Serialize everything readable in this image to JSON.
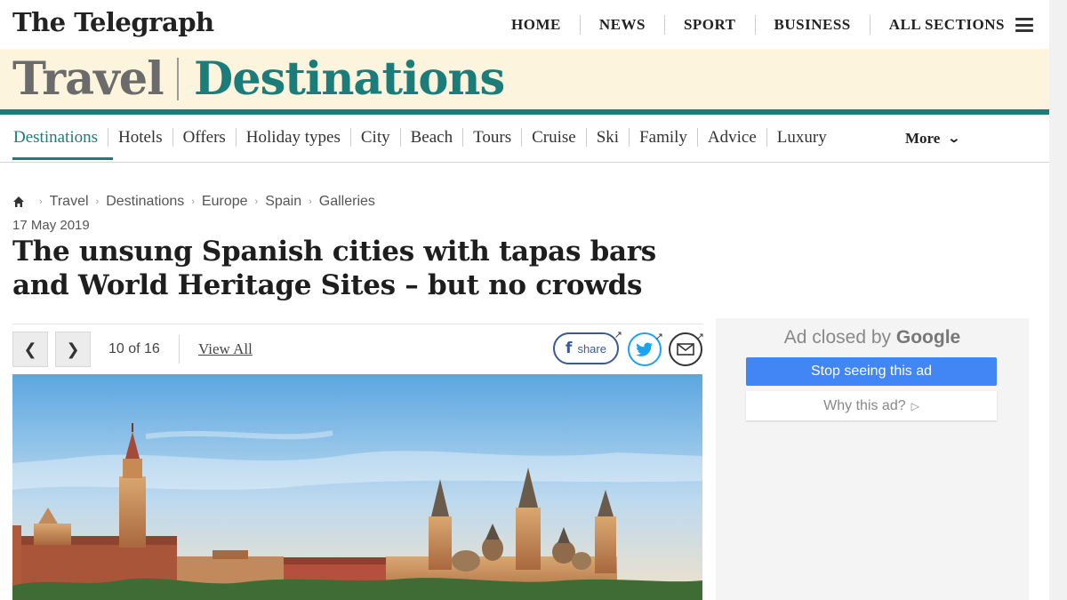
{
  "header": {
    "logo": "The Telegraph",
    "nav": [
      "HOME",
      "NEWS",
      "SPORT",
      "BUSINESS",
      "ALL SECTIONS"
    ],
    "menu_icon": "hamburger-icon"
  },
  "section": {
    "primary": "Travel",
    "secondary": "Destinations"
  },
  "subnav": {
    "items": [
      "Destinations",
      "Hotels",
      "Offers",
      "Holiday types",
      "City",
      "Beach",
      "Tours",
      "Cruise",
      "Ski",
      "Family",
      "Advice",
      "Luxury"
    ],
    "more_label": "More"
  },
  "breadcrumb": [
    "Travel",
    "Destinations",
    "Europe",
    "Spain",
    "Galleries"
  ],
  "article": {
    "date": "17 May 2019",
    "headline": "The unsung Spanish cities with tapas bars and World Heritage Sites – but no crowds"
  },
  "gallery": {
    "counter": "10 of 16",
    "view_all": "View All",
    "share_label": "share"
  },
  "ad": {
    "closed_prefix": "Ad closed by",
    "closed_brand": "Google",
    "stop_label": "Stop seeing this ad",
    "why_label": "Why this ad?"
  },
  "colors": {
    "accent": "#1a7d7a",
    "band": "#fcf4dd",
    "facebook": "#3b5998",
    "twitter": "#1da1f2",
    "google_button": "#4285f4"
  }
}
